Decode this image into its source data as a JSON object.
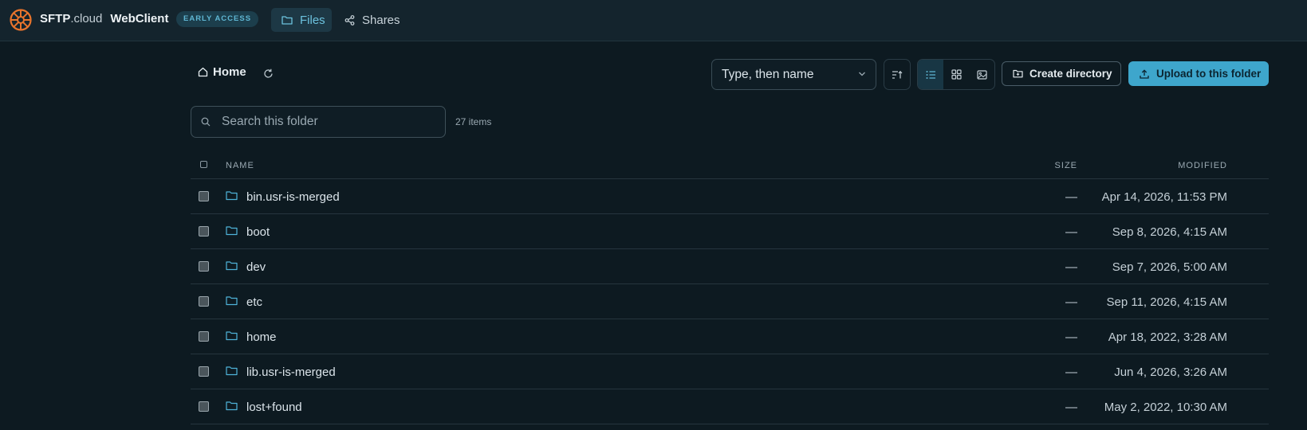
{
  "app": {
    "brand_bold": "SFTP",
    "brand_suffix": ".cloud",
    "product": "WebClient",
    "badge": "EARLY ACCESS"
  },
  "nav": {
    "files": "Files",
    "shares": "Shares"
  },
  "breadcrumb": {
    "home": "Home"
  },
  "toolbar": {
    "sort_value": "Type, then name",
    "create_directory": "Create directory",
    "upload": "Upload to this folder"
  },
  "search": {
    "placeholder": "Search this folder"
  },
  "items_count": "27 items",
  "table": {
    "headers": {
      "name": "NAME",
      "size": "SIZE",
      "modified": "MODIFIED"
    },
    "rows": [
      {
        "name": "bin.usr-is-merged",
        "size": "—",
        "modified": "Apr 14, 2026, 11:53 PM"
      },
      {
        "name": "boot",
        "size": "—",
        "modified": "Sep 8, 2026, 4:15 AM"
      },
      {
        "name": "dev",
        "size": "—",
        "modified": "Sep 7, 2026, 5:00 AM"
      },
      {
        "name": "etc",
        "size": "—",
        "modified": "Sep 11, 2026, 4:15 AM"
      },
      {
        "name": "home",
        "size": "—",
        "modified": "Apr 18, 2022, 3:28 AM"
      },
      {
        "name": "lib.usr-is-merged",
        "size": "—",
        "modified": "Jun 4, 2026, 3:26 AM"
      },
      {
        "name": "lost+found",
        "size": "—",
        "modified": "May 2, 2022, 10:30 AM"
      }
    ]
  },
  "colors": {
    "background": "#0d1a21",
    "topbar": "#14242d",
    "accent": "#3ea6cc",
    "logo": "#e8742c",
    "folder_icon": "#4fb3d9"
  },
  "icons": {
    "logo": "ship-wheel-icon",
    "files": "folder-icon",
    "shares": "share-icon",
    "home": "home-icon",
    "refresh": "refresh-icon",
    "sort_dir": "sort-ascending-icon",
    "list_view": "list-icon",
    "grid_view": "grid-icon",
    "gallery_view": "image-icon",
    "create_dir": "folder-plus-icon",
    "upload": "upload-icon",
    "search": "search-icon",
    "row": "folder-icon"
  }
}
